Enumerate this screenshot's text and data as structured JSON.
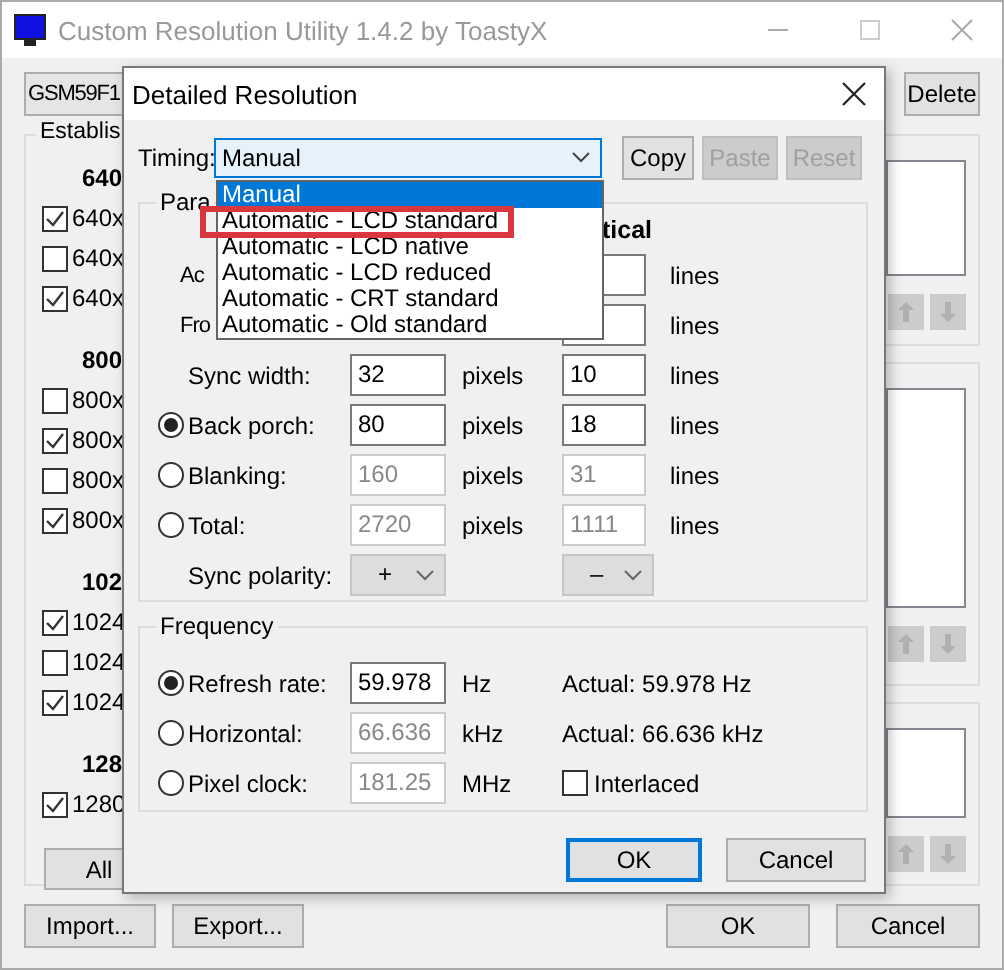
{
  "window": {
    "title": "Custom Resolution Utility 1.4.2 by ToastyX"
  },
  "monitor_select": {
    "value": "GSM59F1"
  },
  "delete_button": "Delete",
  "established": {
    "title": "Establis",
    "sections": [
      {
        "heading": "640",
        "items": [
          {
            "label": "640x",
            "checked": true
          },
          {
            "label": "640x",
            "checked": false
          },
          {
            "label": "640x",
            "checked": true
          }
        ]
      },
      {
        "heading": "800",
        "items": [
          {
            "label": "800x",
            "checked": false
          },
          {
            "label": "800x",
            "checked": true
          },
          {
            "label": "800x",
            "checked": false
          },
          {
            "label": "800x",
            "checked": true
          }
        ]
      },
      {
        "heading": "102",
        "items": [
          {
            "label": "1024",
            "checked": true
          },
          {
            "label": "1024",
            "checked": false
          },
          {
            "label": "1024",
            "checked": true
          }
        ]
      },
      {
        "heading": "128",
        "items": [
          {
            "label": "1280",
            "checked": true
          }
        ]
      }
    ],
    "all_button": "All"
  },
  "bottom_buttons": {
    "left": [
      "Import...",
      "Export..."
    ],
    "right": [
      "OK",
      "Cancel"
    ]
  },
  "dialog": {
    "title": "Detailed Resolution",
    "timing": {
      "label": "Timing:",
      "value": "Manual",
      "options": [
        {
          "label": "Manual",
          "selected": true
        },
        {
          "label": "Automatic - LCD standard",
          "selected": false,
          "highlighted": true
        },
        {
          "label": "Automatic - LCD native",
          "selected": false,
          "highlighted": false
        },
        {
          "label": "Automatic - LCD reduced",
          "selected": false,
          "highlighted": false
        },
        {
          "label": "Automatic - CRT standard",
          "selected": false,
          "highlighted": false
        },
        {
          "label": "Automatic - Old standard",
          "selected": false,
          "highlighted": false
        }
      ]
    },
    "tool_buttons": [
      {
        "label": "Copy",
        "disabled": false
      },
      {
        "label": "Paste",
        "disabled": true
      },
      {
        "label": "Reset",
        "disabled": true
      }
    ],
    "parameters": {
      "title": "Para",
      "vertical_header": "tical",
      "rows": [
        {
          "kind": "covered",
          "label": "Ac",
          "v_unit": "lines"
        },
        {
          "kind": "covered",
          "label": "Fro",
          "v_unit": "lines"
        },
        {
          "kind": "value",
          "label": "Sync width:",
          "h": {
            "value": "32",
            "disabled": false
          },
          "h_unit": "pixels",
          "v": {
            "value": "10",
            "disabled": false
          },
          "v_unit": "lines"
        },
        {
          "kind": "radio",
          "selected": true,
          "label": "Back porch:",
          "h": {
            "value": "80",
            "disabled": false
          },
          "h_unit": "pixels",
          "v": {
            "value": "18",
            "disabled": false
          },
          "v_unit": "lines"
        },
        {
          "kind": "radio",
          "selected": false,
          "label": "Blanking:",
          "h": {
            "value": "160",
            "disabled": true
          },
          "h_unit": "pixels",
          "v": {
            "value": "31",
            "disabled": true
          },
          "v_unit": "lines"
        },
        {
          "kind": "radio",
          "selected": false,
          "label": "Total:",
          "h": {
            "value": "2720",
            "disabled": true
          },
          "h_unit": "pixels",
          "v": {
            "value": "1111",
            "disabled": true
          },
          "v_unit": "lines"
        },
        {
          "kind": "polarity",
          "label": "Sync polarity:",
          "h_value": "+",
          "v_value": "–"
        }
      ]
    },
    "frequency": {
      "title": "Frequency",
      "rows": [
        {
          "kind": "radio",
          "selected": true,
          "label": "Refresh rate:",
          "value": "59.978",
          "disabled": false,
          "unit": "Hz",
          "actual": "Actual: 59.978 Hz"
        },
        {
          "kind": "radio",
          "selected": false,
          "label": "Horizontal:",
          "value": "66.636",
          "disabled": true,
          "unit": "kHz",
          "actual": "Actual: 66.636 kHz"
        },
        {
          "kind": "radio",
          "selected": false,
          "label": "Pixel clock:",
          "value": "181.25",
          "disabled": true,
          "unit": "MHz",
          "checkbox": {
            "label": "Interlaced",
            "checked": false
          }
        }
      ]
    },
    "buttons": [
      {
        "label": "OK",
        "default": true
      },
      {
        "label": "Cancel",
        "default": false
      }
    ]
  }
}
